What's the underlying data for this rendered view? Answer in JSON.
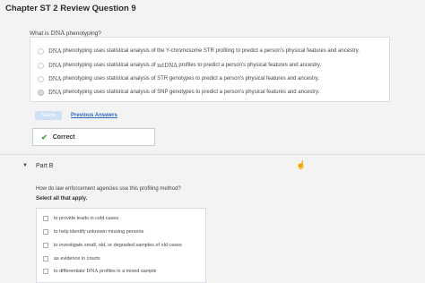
{
  "page": {
    "title": "Chapter ST 2 Review Question 9"
  },
  "part_a": {
    "question_prefix": "What is",
    "question_acronym": "DNA",
    "question_suffix": "phenotyping?",
    "options": [
      {
        "acronym": "DNA",
        "text": "phenotyping uses statistical analysis of the Y-chromosome STR profiling to predict a person's physical features and ancestry.",
        "selected": false
      },
      {
        "acronym": "DNA",
        "text_before": "phenotyping uses statistical analysis of",
        "mid_acronym": "mtDNA",
        "text_after": "profiles to predict a person's physical features and ancestry.",
        "selected": false
      },
      {
        "acronym": "DNA",
        "text": "phenotyping uses statistical analysis of STR genotypes to predict a person's physical features and ancestry.",
        "selected": false
      },
      {
        "acronym": "DNA",
        "text": "phenotyping uses statistical analysis of SNP genotypes to predict a person's physical features and ancestry.",
        "selected": true
      }
    ],
    "submit_label": "Submit",
    "previous_answers_label": "Previous Answers",
    "result_label": "Correct"
  },
  "part_b": {
    "toggle_glyph": "▼",
    "label": "Part B",
    "question": "How do law enforcement agencies use this profiling method?",
    "instruction": "Select all that apply.",
    "options": [
      {
        "text": "to provide leads in cold cases"
      },
      {
        "text": "to help identify unknown missing persons"
      },
      {
        "text": "to investigate small, old, or degraded samples of old cases"
      },
      {
        "text": "as evidence in courts"
      },
      {
        "text_before": "to differentiate",
        "acronym": "DNA",
        "text_after": "profiles in a mixed sample"
      }
    ]
  },
  "icons": {
    "check": "check-icon",
    "cursor": "hand-cursor-icon"
  },
  "colors": {
    "link": "#2a6ab8",
    "check": "#3a9a3a",
    "submit_bg": "#cfe1f5"
  }
}
